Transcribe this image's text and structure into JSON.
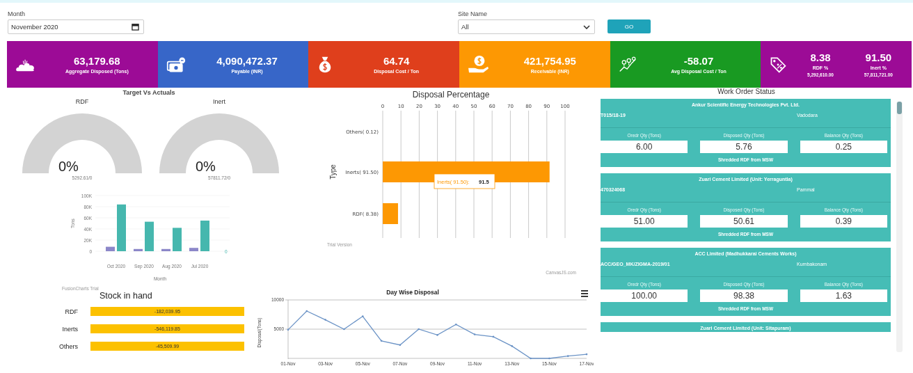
{
  "filters": {
    "month": {
      "label": "Month",
      "value": "November 2020"
    },
    "site": {
      "label": "Site Name",
      "value": "All"
    },
    "go_button": "GO"
  },
  "kpis": [
    {
      "kind": "single",
      "color": "#9c0b96",
      "value": "63,179.68",
      "label": "Aggregate Disposed (Tons)"
    },
    {
      "kind": "single",
      "color": "#3766c8",
      "value": "4,090,472.37",
      "label": "Payable (INR)"
    },
    {
      "kind": "single",
      "color": "#df3f1c",
      "value": "64.74",
      "label": "Disposal Cost / Ton"
    },
    {
      "kind": "single",
      "color": "#fd9803",
      "value": "421,754.95",
      "label": "Receivable (INR)"
    },
    {
      "kind": "single",
      "color": "#199a22",
      "value": "-58.07",
      "label": "Avg Disposal Cost / Ton"
    },
    {
      "kind": "double",
      "color": "#9c0b96",
      "metrics": [
        {
          "value": "8.38",
          "label": "RDF %",
          "sub": "5,292,610.00"
        },
        {
          "value": "91.50",
          "label": "Inert %",
          "sub": "57,811,721.00"
        }
      ]
    }
  ],
  "target_vs_actuals": {
    "title": "Target Vs Actuals",
    "gauges": [
      {
        "label": "RDF",
        "percent": "0%",
        "detail": "5292.61/0"
      },
      {
        "label": "Inert",
        "percent": "0%",
        "detail": "57811.72/0"
      }
    ],
    "monthly_chart": {
      "chart_data": {
        "type": "bar",
        "ylabel": "Tons",
        "xlabel": "Month",
        "categories": [
          "Oct 2020",
          "Sep 2020",
          "Aug 2020",
          "Jul 2020"
        ],
        "series": [
          {
            "color": "#8c87c9",
            "values": [
              8000,
              4000,
              4000,
              6000
            ]
          },
          {
            "color": "#46b7ae",
            "values": [
              84000,
              53000,
              42000,
              55000
            ]
          }
        ],
        "ylim": [
          0,
          100000
        ],
        "yticks": [
          {
            "value": 0,
            "label": "0"
          },
          {
            "value": 20000,
            "label": "20K"
          },
          {
            "value": 40000,
            "label": "40K"
          },
          {
            "value": 60000,
            "label": "60K"
          },
          {
            "value": 80000,
            "label": "80K"
          },
          {
            "value": 100000,
            "label": "100K"
          }
        ]
      },
      "secondary_axis_label": "0",
      "credit": "FusionCharts Trial"
    }
  },
  "disposal_percentage": {
    "chart_data": {
      "type": "bar",
      "orientation": "horizontal",
      "title": "Disposal Percentage",
      "ylabel": "Type",
      "categories": [
        "Others( 0.12)",
        "Inerts( 91.50)",
        "RDF( 8.38)"
      ],
      "values": [
        0.12,
        91.5,
        8.38
      ],
      "xlim": [
        0,
        100
      ],
      "xticks": [
        0,
        10,
        20,
        30,
        40,
        50,
        60,
        70,
        80,
        90,
        100
      ],
      "grid": true
    },
    "tooltip": {
      "label": "Inerts( 91.50):",
      "value": "91.5"
    },
    "credit_left": "Trial Version",
    "credit_right": "CanvasJS.com"
  },
  "stock_in_hand": {
    "title": "Stock in hand",
    "rows": [
      {
        "label": "RDF",
        "value": "-182,039.95"
      },
      {
        "label": "Inerts",
        "value": "-546,119.85"
      },
      {
        "label": "Others",
        "value": "-45,509.99"
      }
    ]
  },
  "day_wise": {
    "chart_data": {
      "type": "line",
      "title": "Day Wise Disposal",
      "ylabel": "Disposal(Tons)",
      "categories": [
        "01-Nov",
        null,
        "03-Nov",
        null,
        "05-Nov",
        null,
        "07-Nov",
        null,
        "09-Nov",
        null,
        "11-Nov",
        null,
        "13-Nov",
        null,
        "15-Nov",
        null,
        "17-Nov"
      ],
      "series": [
        {
          "color": "#6b93c6",
          "values": [
            4900,
            8100,
            6600,
            5000,
            7200,
            3000,
            2300,
            5000,
            4000,
            5800,
            4100,
            3700,
            2100,
            0,
            0,
            400,
            700
          ]
        }
      ],
      "ylim": [
        0,
        10000
      ],
      "yticks": [
        5000,
        10000
      ]
    }
  },
  "work_orders": {
    "title": "Work Order Status",
    "cards": [
      {
        "company": "Ankur Scientific Energy Technologies Pvt. Ltd.",
        "order": "T015/18-19",
        "location": "Vadodara",
        "quantities": [
          {
            "label": "Oredr Qty (Tons)",
            "value": "6.00"
          },
          {
            "label": "Disposed Qty (Tons)",
            "value": "5.76"
          },
          {
            "label": "Balance Qty (Tons)",
            "value": "0.25"
          }
        ],
        "material": "Shredded RDF from MSW"
      },
      {
        "company": "Zuari Cement Limited (Unit: Yerraguntla)",
        "order": "470324068",
        "location": "Pammal",
        "quantities": [
          {
            "label": "Oredr Qty (Tons)",
            "value": "51.00"
          },
          {
            "label": "Disposed Qty (Tons)",
            "value": "50.61"
          },
          {
            "label": "Balance Qty (Tons)",
            "value": "0.39"
          }
        ],
        "material": "Shredded RDF from MSW"
      },
      {
        "company": "ACC Limited (Madhukkarai Cements Works)",
        "order": "ACC/GEO_MK/ZIGMA-2019/01",
        "location": "Kumbakonam",
        "quantities": [
          {
            "label": "Oredr Qty (Tons)",
            "value": "100.00"
          },
          {
            "label": "Disposed Qty (Tons)",
            "value": "98.38"
          },
          {
            "label": "Balance Qty (Tons)",
            "value": "1.63"
          }
        ],
        "material": "Shredded RDF from MSW"
      },
      {
        "company": "Zuari Cement Limited (Unit: Sitapuram)"
      }
    ]
  }
}
